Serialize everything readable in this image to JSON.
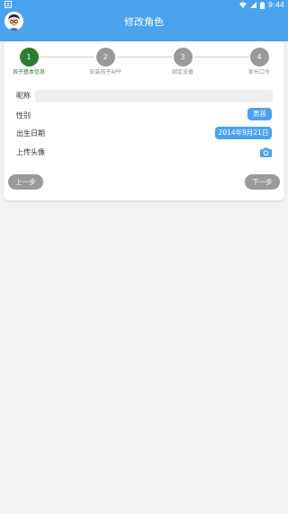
{
  "status_bar": {
    "time": "9:44",
    "icons": [
      "wifi-icon",
      "signal-icon",
      "battery-icon"
    ]
  },
  "header": {
    "title": "修改角色",
    "avatar": "child-avatar-icon"
  },
  "steps": [
    {
      "number": "1",
      "label": "孩子基本信息",
      "active": true
    },
    {
      "number": "2",
      "label": "安装孩子APP",
      "active": false
    },
    {
      "number": "3",
      "label": "绑定设备",
      "active": false
    },
    {
      "number": "4",
      "label": "家长口令",
      "active": false
    }
  ],
  "form": {
    "nickname_label": "昵称",
    "nickname_value": "",
    "gender_label": "性别",
    "gender_value": "男孩",
    "birthday_label": "出生日期",
    "birthday_value": "2014年9月21日",
    "avatar_label": "上传头像",
    "avatar_icon": "camera-icon"
  },
  "nav": {
    "prev_label": "上一步",
    "next_label": "下一步"
  },
  "colors": {
    "accent": "#4ba3ee",
    "active_step": "#2e7d32",
    "inactive": "#9a9a9a"
  }
}
